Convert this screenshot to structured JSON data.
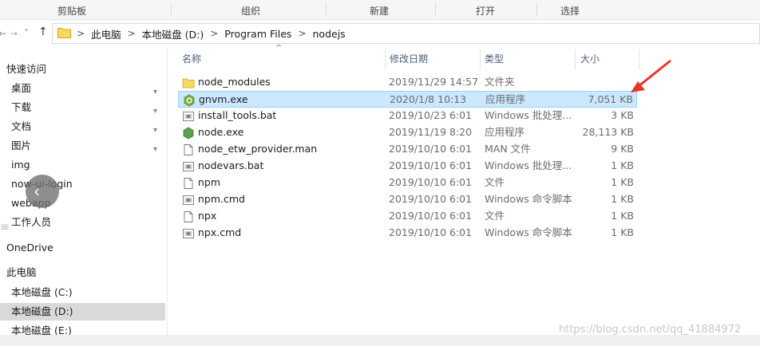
{
  "ribbon": {
    "groups": [
      "剪贴板",
      "组织",
      "新建",
      "打开",
      "选择"
    ]
  },
  "address": {
    "back_glyph": "←",
    "forward_glyph": "→",
    "recent_glyph": "˅",
    "up_glyph": "↑",
    "crumbs": [
      "此电脑",
      "本地磁盘 (D:)",
      "Program Files",
      "nodejs"
    ],
    "chevron": ">"
  },
  "sidebar": {
    "items": [
      {
        "label": "快速访问",
        "head": true,
        "pinned": false
      },
      {
        "label": "桌面",
        "pinned": true
      },
      {
        "label": "下载",
        "pinned": true
      },
      {
        "label": "文档",
        "pinned": true
      },
      {
        "label": "图片",
        "pinned": true
      },
      {
        "label": "img",
        "pinned": false
      },
      {
        "label": "now-ui-login",
        "pinned": false
      },
      {
        "label": "webapp",
        "pinned": false
      },
      {
        "label": "工作人员",
        "pinned": false
      },
      {
        "label": "OneDrive",
        "head": true,
        "pinned": false
      },
      {
        "label": "此电脑",
        "head": true,
        "pinned": false
      },
      {
        "label": "本地磁盘 (C:)",
        "pinned": false
      },
      {
        "label": "本地磁盘 (D:)",
        "pinned": false,
        "selected": true
      },
      {
        "label": "本地磁盘 (E:)",
        "pinned": false
      }
    ],
    "pin_glyph": "📌"
  },
  "columns": {
    "name": "名称",
    "date": "修改日期",
    "type": "类型",
    "size": "大小",
    "sort_caret": "^"
  },
  "files": [
    {
      "name": "node_modules",
      "date": "2019/11/29 14:57",
      "type": "文件夹",
      "size": "",
      "icon": "folder-icon"
    },
    {
      "name": "gnvm.exe",
      "date": "2020/1/8 10:13",
      "type": "应用程序",
      "size": "7,051 KB",
      "icon": "gnvm-exe-icon",
      "selected": true
    },
    {
      "name": "install_tools.bat",
      "date": "2019/10/23 6:01",
      "type": "Windows 批处理...",
      "size": "3 KB",
      "icon": "batch-file-icon"
    },
    {
      "name": "node.exe",
      "date": "2019/11/19 8:20",
      "type": "应用程序",
      "size": "28,113 KB",
      "icon": "node-exe-icon"
    },
    {
      "name": "node_etw_provider.man",
      "date": "2019/10/10 6:01",
      "type": "MAN 文件",
      "size": "9 KB",
      "icon": "file-icon"
    },
    {
      "name": "nodevars.bat",
      "date": "2019/10/10 6:01",
      "type": "Windows 批处理...",
      "size": "1 KB",
      "icon": "batch-file-icon"
    },
    {
      "name": "npm",
      "date": "2019/10/10 6:01",
      "type": "文件",
      "size": "1 KB",
      "icon": "file-icon"
    },
    {
      "name": "npm.cmd",
      "date": "2019/10/10 6:01",
      "type": "Windows 命令脚本",
      "size": "1 KB",
      "icon": "batch-file-icon"
    },
    {
      "name": "npx",
      "date": "2019/10/10 6:01",
      "type": "文件",
      "size": "1 KB",
      "icon": "file-icon"
    },
    {
      "name": "npx.cmd",
      "date": "2019/10/10 6:01",
      "type": "Windows 命令脚本",
      "size": "1 KB",
      "icon": "batch-file-icon"
    }
  ],
  "watermark": "https://blog.csdn.net/qq_41884972",
  "colors": {
    "selection_bg": "#cce8ff",
    "selection_border": "#99d1ff",
    "header_text": "#4c607a",
    "annotation_arrow": "#e8342a",
    "node_green": "#5fa04e"
  }
}
